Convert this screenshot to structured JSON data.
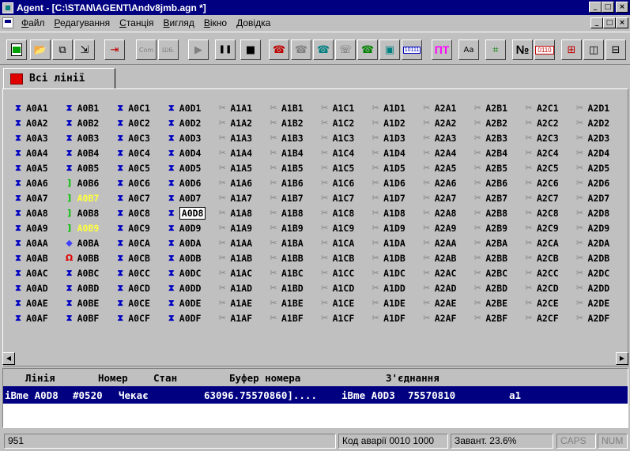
{
  "window": {
    "title": "Agent - [C:\\STAN\\AGENT\\Andv8jmb.agn *]",
    "min_label": "_",
    "max_label": "□",
    "close_label": "×"
  },
  "menu": {
    "items": [
      {
        "accel": "Ф",
        "rest": "айл"
      },
      {
        "accel": "Р",
        "rest": "едагування"
      },
      {
        "accel": "С",
        "rest": "танція"
      },
      {
        "accel": "В",
        "rest": "игляд"
      },
      {
        "accel": "В",
        "rest": "ікно"
      },
      {
        "accel": "Д",
        "rest": "овідка"
      }
    ]
  },
  "toolbar": {
    "com_label": "Com",
    "sh_label": "Ш6.",
    "play_glyph": "▶",
    "pause_glyph": "❚❚",
    "stop_glyph": "■",
    "bits_label": "10111",
    "pt_label": "ПТ",
    "aa_label": "Aa",
    "n_label": "№",
    "bits2_label": "0110"
  },
  "tab": {
    "label": "Всі лінії"
  },
  "grid": {
    "columns": [
      "A0A",
      "A0B",
      "A0C",
      "A0D",
      "A1A",
      "A1B",
      "A1C",
      "A1D",
      "A2A",
      "A2B",
      "A2C",
      "A2D"
    ],
    "row_suffixes": [
      "1",
      "2",
      "3",
      "4",
      "5",
      "6",
      "7",
      "8",
      "9",
      "A",
      "B",
      "C",
      "D",
      "E",
      "F"
    ],
    "selected": "A0D8"
  },
  "lines_table": {
    "headers": [
      "Лінія",
      "Номер",
      "Стан",
      "Буфер номера",
      "З'єднання"
    ],
    "rows": [
      {
        "line": "iBme A0D8",
        "number": "#0520",
        "state": "Чекає",
        "buffer": "63096.75570860]....",
        "connection": "iBme A0D3",
        "conn_number": "75570810",
        "extra": "a1"
      }
    ]
  },
  "status": {
    "left": "951",
    "alarm_code": "Код аварії 0010 1000",
    "load": "Завант. 23.6%",
    "caps": "CAPS",
    "num": "NUM"
  }
}
